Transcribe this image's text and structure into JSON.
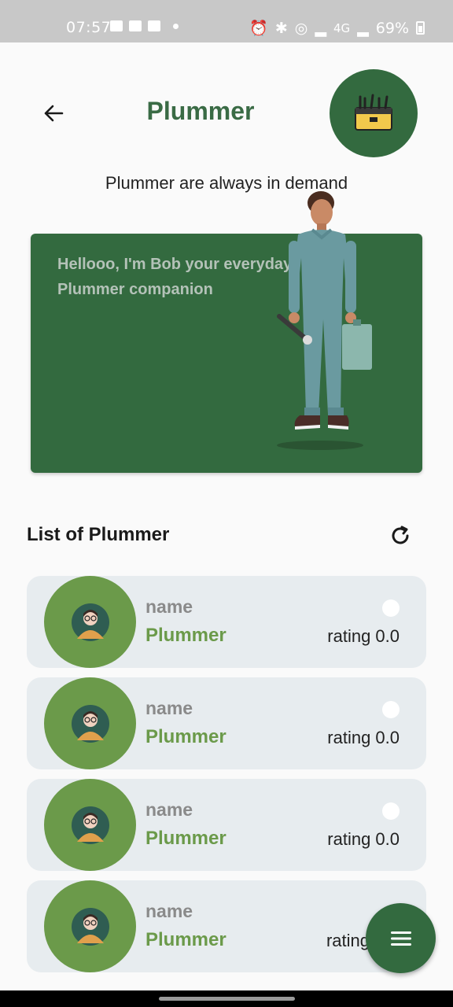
{
  "status_bar": {
    "time": "07:57",
    "network": "4G",
    "battery": "69%",
    "left_icons": [
      "gallery-icon",
      "folder-icon",
      "sim-icon",
      "dot-icon"
    ],
    "right_icons": [
      "alarm-icon",
      "bluetooth-icon",
      "hotspot-icon",
      "signal-icon",
      "battery-icon"
    ]
  },
  "header": {
    "title": "Plummer",
    "back_icon": "arrow-left-icon",
    "avatar_icon": "toolbox-icon"
  },
  "subtitle": "Plummer are always in demand",
  "banner": {
    "text": "Hellooo, I'm Bob your everyday Plummer companion",
    "mascot": "plumber-mascot"
  },
  "list": {
    "title": "List of Plummer",
    "refresh_icon": "refresh-icon",
    "items": [
      {
        "name": "name",
        "role": "Plummer",
        "rating": "rating 0.0"
      },
      {
        "name": "name",
        "role": "Plummer",
        "rating": "rating 0.0"
      },
      {
        "name": "name",
        "role": "Plummer",
        "rating": "rating 0.0"
      },
      {
        "name": "name",
        "role": "Plummer",
        "rating": "rating"
      }
    ]
  },
  "fab": {
    "icon": "menu-icon"
  },
  "colors": {
    "primary": "#336a3f",
    "accent": "#6b9a4a",
    "card": "#e7ecef",
    "title": "#3a6b45"
  }
}
